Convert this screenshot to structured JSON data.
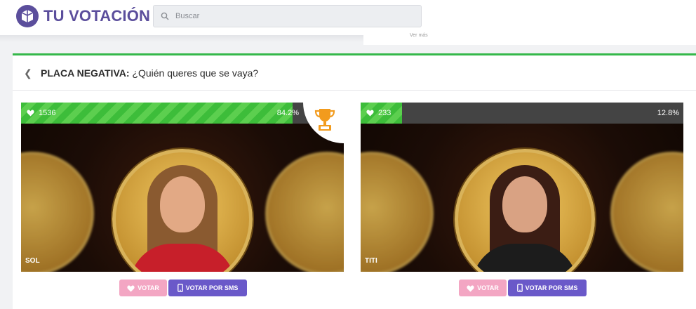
{
  "header": {
    "brand": "TU VOTACIÓN",
    "search_placeholder": "Buscar",
    "ghost_text": "Ver más"
  },
  "poll": {
    "back_icon": "chevron-left-icon",
    "title_bold": "PLACA NEGATIVA:",
    "title_rest": " ¿Quién queres que se vaya?",
    "accent_color": "#35b84a"
  },
  "candidates": [
    {
      "name": "SOL",
      "votes": "1536",
      "percent_label": "84.2%",
      "percent_value": 84.2,
      "winner": true,
      "vote_label": "VOTAR",
      "sms_label": "VOTAR POR SMS"
    },
    {
      "name": "TITI",
      "votes": "233",
      "percent_label": "12.8%",
      "percent_value": 12.8,
      "winner": false,
      "vote_label": "VOTAR",
      "sms_label": "VOTAR POR SMS"
    }
  ],
  "colors": {
    "brand": "#5b4e9c",
    "vote_button": "#f3a6c3",
    "sms_button": "#6a59c9",
    "bar_fill": "#3dbd3a"
  }
}
